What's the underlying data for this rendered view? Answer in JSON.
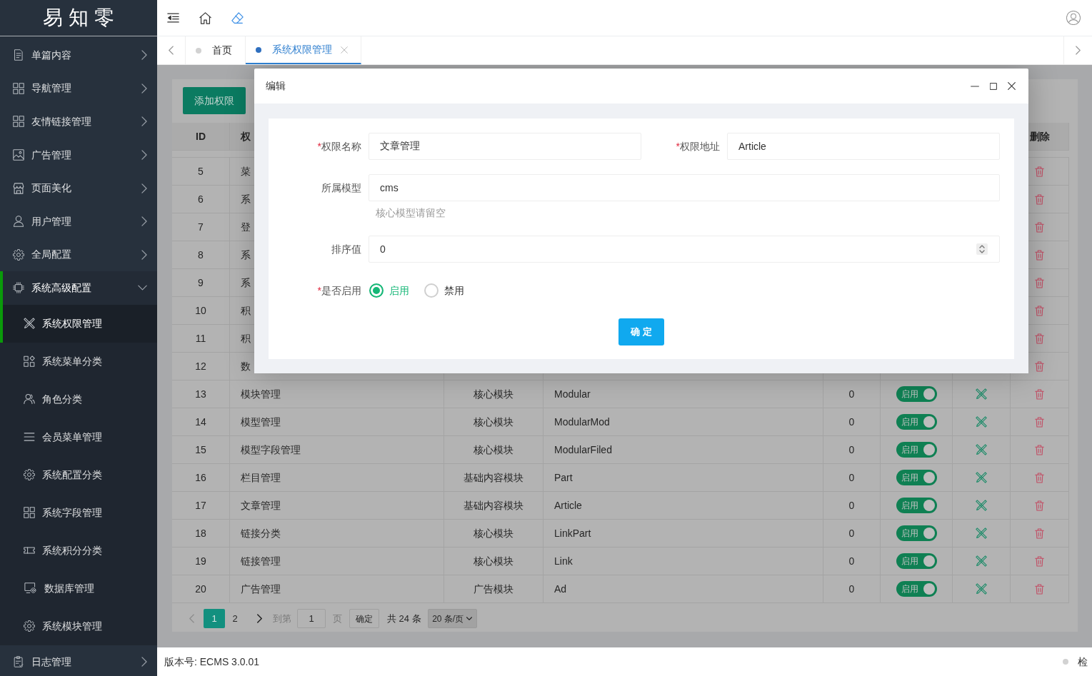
{
  "sidebar": {
    "logo": "易知零",
    "items": [
      {
        "label": "单篇内容",
        "expanded": false
      },
      {
        "label": "导航管理",
        "expanded": false
      },
      {
        "label": "友情链接管理",
        "expanded": false
      },
      {
        "label": "广告管理",
        "expanded": false
      },
      {
        "label": "页面美化",
        "expanded": false
      },
      {
        "label": "用户管理",
        "expanded": false
      },
      {
        "label": "全局配置",
        "expanded": false
      },
      {
        "label": "系统高级配置",
        "expanded": true,
        "children": [
          {
            "label": "系统权限管理",
            "selected": true
          },
          {
            "label": "系统菜单分类",
            "selected": false
          },
          {
            "label": "角色分类",
            "selected": false
          },
          {
            "label": "会员菜单管理",
            "selected": false
          },
          {
            "label": "系统配置分类",
            "selected": false
          },
          {
            "label": "系统字段管理",
            "selected": false
          },
          {
            "label": "系统积分分类",
            "selected": false
          },
          {
            "label": "数据库管理",
            "selected": false
          },
          {
            "label": "系统模块管理",
            "selected": false
          }
        ]
      },
      {
        "label": "日志管理",
        "expanded": false
      }
    ]
  },
  "tabs": [
    {
      "label": "首页",
      "selected": false,
      "closable": false
    },
    {
      "label": "系统权限管理",
      "selected": true,
      "closable": true
    }
  ],
  "toolbar": {
    "add_button": "添加权限"
  },
  "table": {
    "header": {
      "id": "ID",
      "column_2": "权",
      "delete": "删除"
    },
    "rows": [
      {
        "kind": "partial",
        "id": "5",
        "column_2": "菜"
      },
      {
        "kind": "partial",
        "id": "6",
        "column_2": "系"
      },
      {
        "kind": "partial",
        "id": "7",
        "column_2": "登"
      },
      {
        "kind": "partial",
        "id": "8",
        "column_2": "系"
      },
      {
        "kind": "partial",
        "id": "9",
        "column_2": "系"
      },
      {
        "kind": "partial",
        "id": "10",
        "column_2": "积"
      },
      {
        "kind": "partial",
        "id": "11",
        "column_2": "积"
      },
      {
        "kind": "partial",
        "id": "12",
        "column_2": "数"
      },
      {
        "kind": "full",
        "id": "13",
        "column_2": "模块管理",
        "column_3": "核心模块",
        "column_4": "Modular",
        "column_5": "0",
        "column_6": {
          "label": "启用",
          "on": true
        }
      },
      {
        "kind": "full",
        "id": "14",
        "column_2": "模型管理",
        "column_3": "核心模块",
        "column_4": "ModularMod",
        "column_5": "0",
        "column_6": {
          "label": "启用",
          "on": true
        }
      },
      {
        "kind": "full",
        "id": "15",
        "column_2": "模型字段管理",
        "column_3": "核心模块",
        "column_4": "ModularFiled",
        "column_5": "0",
        "column_6": {
          "label": "启用",
          "on": true
        }
      },
      {
        "kind": "full",
        "id": "16",
        "column_2": "栏目管理",
        "column_3": "基础内容模块",
        "column_4": "Part",
        "column_5": "0",
        "column_6": {
          "label": "启用",
          "on": true
        }
      },
      {
        "kind": "full",
        "id": "17",
        "column_2": "文章管理",
        "column_3": "基础内容模块",
        "column_4": "Article",
        "column_5": "0",
        "column_6": {
          "label": "启用",
          "on": true
        }
      },
      {
        "kind": "full",
        "id": "18",
        "column_2": "链接分类",
        "column_3": "核心模块",
        "column_4": "LinkPart",
        "column_5": "0",
        "column_6": {
          "label": "启用",
          "on": true
        }
      },
      {
        "kind": "full",
        "id": "19",
        "column_2": "链接管理",
        "column_3": "核心模块",
        "column_4": "Link",
        "column_5": "0",
        "column_6": {
          "label": "启用",
          "on": true
        }
      },
      {
        "kind": "full",
        "id": "20",
        "column_2": "广告管理",
        "column_3": "广告模块",
        "column_4": "Ad",
        "column_5": "0",
        "column_6": {
          "label": "启用",
          "on": true
        }
      }
    ]
  },
  "pagination": {
    "prev": {
      "disabled": true
    },
    "pages": [
      {
        "label": "1",
        "selected": true
      },
      {
        "label": "2",
        "selected": false
      }
    ],
    "next": {
      "disabled": false
    },
    "goto_label": "到第",
    "goto_value": "1",
    "goto_unit": "页",
    "goto_button": "确定",
    "total": "共 24 条",
    "page_size": "20 条/页"
  },
  "dialog": {
    "title": "编辑",
    "rows": [
      [
        {
          "kind": "text",
          "label": "权限名称",
          "required_mark": "*",
          "value": "文章管理"
        },
        {
          "kind": "text",
          "label": "权限地址",
          "required_mark": "*",
          "value": "Article"
        }
      ],
      [
        {
          "kind": "text",
          "label": "所属模型",
          "value": "cms",
          "help": "核心模型请留空"
        }
      ],
      [
        {
          "kind": "number",
          "label": "排序值",
          "value": "0"
        }
      ],
      [
        {
          "kind": "radio",
          "label": "是否启用",
          "required_mark": "*",
          "options": [
            {
              "label": "启用",
              "selected": true
            },
            {
              "label": "禁用",
              "selected": false
            }
          ]
        }
      ]
    ],
    "submit": "确 定"
  },
  "status_bar": {
    "version": "版本号: ECMS 3.0.01",
    "right_text": "检"
  }
}
